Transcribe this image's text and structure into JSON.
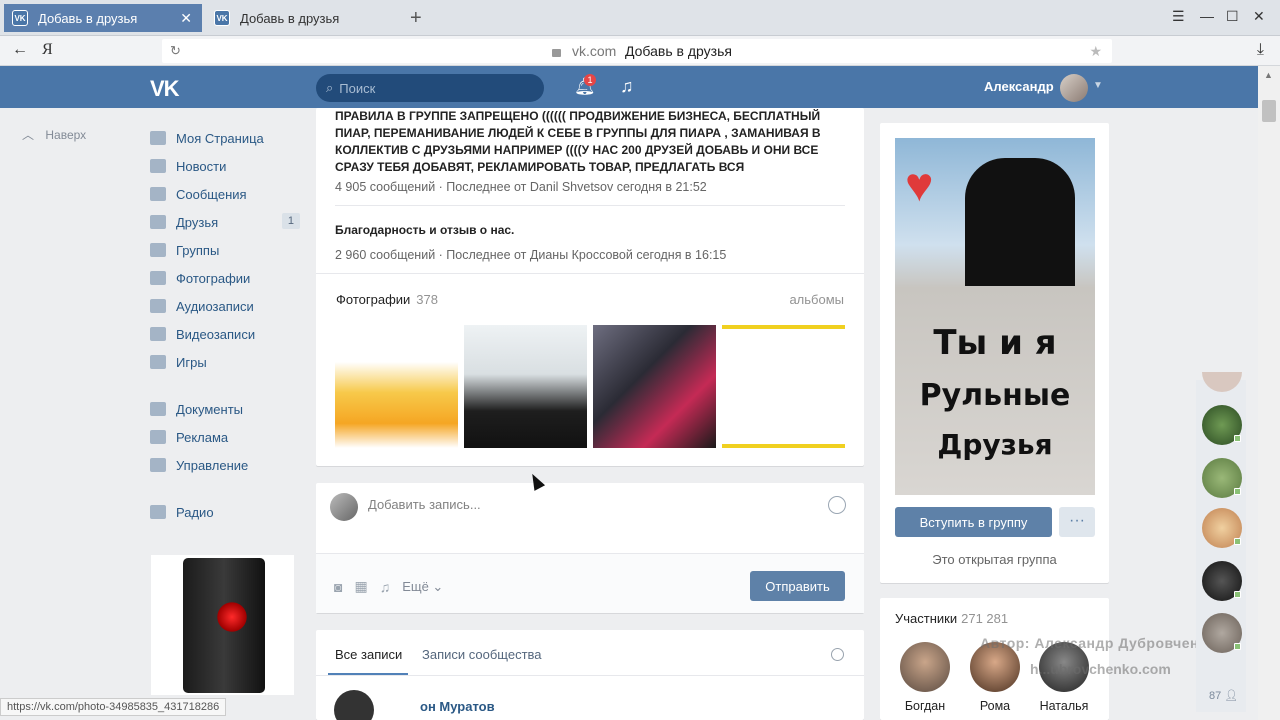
{
  "browser": {
    "tabs": [
      {
        "label": "Добавь в друзья",
        "active": true
      },
      {
        "label": "Добавь в друзья",
        "active": false
      }
    ],
    "url_domain": "vk.com",
    "url_title": "Добавь в друзья",
    "status_url": "https://vk.com/photo-34985835_431718286"
  },
  "header": {
    "logo": "VK",
    "search_placeholder": "Поиск",
    "notifications": "1",
    "user_name": "Александр"
  },
  "sidebar": {
    "up_label": "Наверх",
    "items": [
      {
        "label": "Моя Страница"
      },
      {
        "label": "Новости"
      },
      {
        "label": "Сообщения"
      },
      {
        "label": "Друзья",
        "count": "1"
      },
      {
        "label": "Группы"
      },
      {
        "label": "Фотографии"
      },
      {
        "label": "Аудиозаписи"
      },
      {
        "label": "Видеозаписи"
      },
      {
        "label": "Игры"
      },
      {
        "label": "Документы"
      },
      {
        "label": "Реклама"
      },
      {
        "label": "Управление"
      },
      {
        "label": "Радио"
      }
    ]
  },
  "discussions": [
    {
      "title": "ПРАВИЛА В ГРУППЕ ЗАПРЕЩЕНО (((((( ПРОДВИЖЕНИЕ БИЗНЕСА, БЕСПЛАТНЫЙ ПИАР, ПЕРЕМАНИВАНИЕ ЛЮДЕЙ К СЕБЕ В ГРУППЫ ДЛЯ ПИАРА , ЗАМАНИВАЯ В КОЛЛЕКТИВ С ДРУЗЬЯМИ НАПРИМЕР ((((У НАС 200 ДРУЗЕЙ ДОБАВЬ И ОНИ ВСЕ СРАЗУ ТЕБЯ ДОБАВЯТ, РЕКЛАМИРОВАТЬ ТОВАР, ПРЕДЛАГАТЬ ВСЯ",
      "meta": "4 905 сообщений  ·  Последнее от Danil Shvetsov сегодня в 21:52"
    },
    {
      "title": "Благодарность и отзыв о нас.",
      "meta": "2 960 сообщений  ·  Последнее от Дианы Кроссовой сегодня в 16:15"
    }
  ],
  "photos": {
    "title": "Фотографии",
    "count": "378",
    "albums_link": "альбомы"
  },
  "post": {
    "placeholder": "Добавить запись...",
    "more_label": "Ещё",
    "send_label": "Отправить"
  },
  "wall": {
    "tab_all": "Все записи",
    "tab_community": "Записи сообщества",
    "author_partial": "он Муратов"
  },
  "group": {
    "cover_lines": [
      "Ты и я",
      "Рульные",
      "Друзья"
    ],
    "join_label": "Вступить в группу",
    "more_label": "···",
    "type_label": "Это открытая группа"
  },
  "members": {
    "title": "Участники",
    "count": "271 281",
    "list": [
      {
        "name": "Богдан"
      },
      {
        "name": "Рома"
      },
      {
        "name": "Наталья"
      }
    ]
  },
  "watermark": {
    "line1": "Автор: Александр Дубровченко",
    "line2": "h...ubrovchenko.com"
  },
  "friends_strip": {
    "count": "87"
  }
}
